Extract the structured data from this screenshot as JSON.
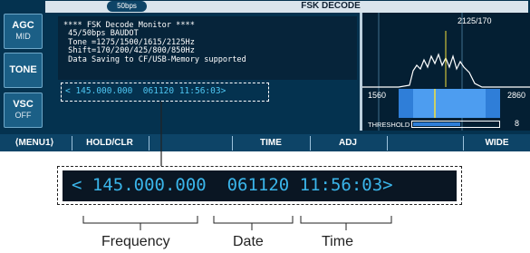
{
  "side_buttons": [
    {
      "label": "AGC",
      "sub": "MID"
    },
    {
      "label": "TONE",
      "sub": ""
    },
    {
      "label": "VSC",
      "sub": "OFF"
    }
  ],
  "title_bar": {
    "speed_tab": "50bps",
    "title": "FSK DECODE"
  },
  "decode_message": {
    "lines": [
      "**** FSK Decode Monitor ****",
      " 45/50bps BAUDOT",
      " Tone =1275/1500/1615/2125Hz",
      " Shift=170/200/425/800/850Hz",
      " Data Saving to CF/USB-Memory supported"
    ]
  },
  "stamp_line": "< 145.000.000  061120 11:56:03>",
  "scope": {
    "center_readout": "2125/170",
    "left_freq": "1560",
    "right_freq": "2860",
    "threshold_label": "THRESHOLD",
    "threshold_value": "8",
    "threshold_level": 0.55
  },
  "function_keys": [
    "⟨MENU1⟩",
    "HOLD/CLR",
    "",
    "TIME",
    "ADJ",
    "",
    "WIDE"
  ],
  "zoom_line": "< 145.000.000  061120 11:56:03>",
  "labels": {
    "frequency": "Frequency",
    "date": "Date",
    "time": "Time"
  },
  "colors": {
    "screen_bg": "#04324f",
    "text_cyan": "#3ab5ea",
    "accent_yellow": "#f5e13b"
  }
}
